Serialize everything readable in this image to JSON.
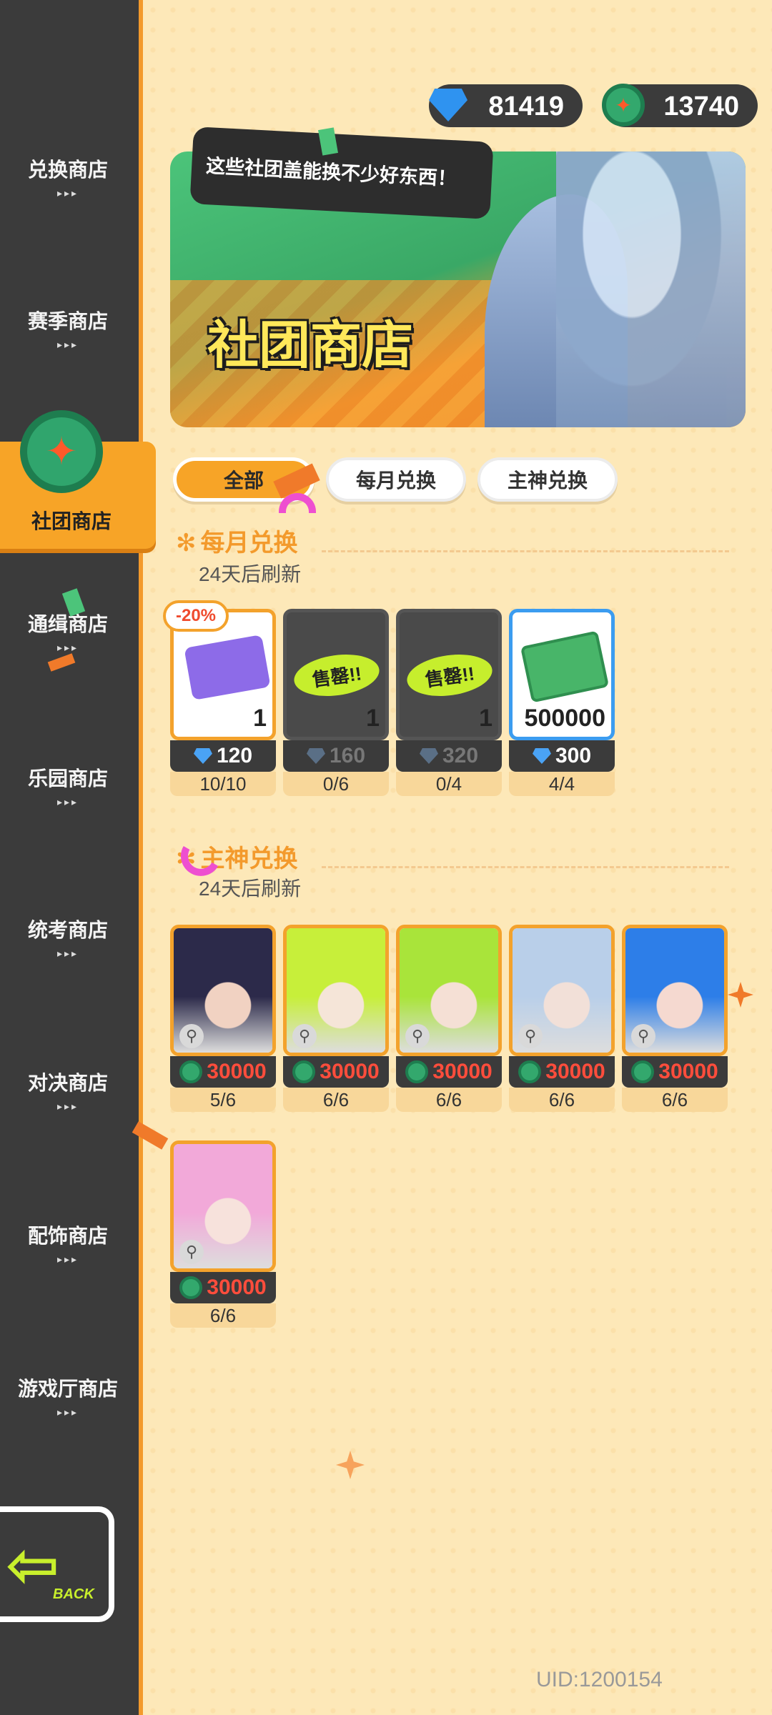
{
  "sidebar": {
    "items": [
      {
        "label": "兑换商店"
      },
      {
        "label": "赛季商店"
      },
      {
        "label": "社团商店"
      },
      {
        "label": "通缉商店"
      },
      {
        "label": "乐园商店"
      },
      {
        "label": "统考商店"
      },
      {
        "label": "对决商店"
      },
      {
        "label": "配饰商店"
      },
      {
        "label": "游戏厅商店"
      }
    ],
    "active_label": "社团商店",
    "dots": "▸▸▸",
    "back_label": "BACK"
  },
  "currency": {
    "gems": "81419",
    "caps": "13740"
  },
  "banner": {
    "speech": "这些社团盖能换不少好东西！",
    "title": "社团商店"
  },
  "tabs": [
    {
      "label": "全部",
      "active": true
    },
    {
      "label": "每月兑换",
      "active": false
    },
    {
      "label": "主神兑换",
      "active": false
    }
  ],
  "sections": {
    "monthly": {
      "title": "每月兑换",
      "refresh": "24天后刷新",
      "items": [
        {
          "qty": "1",
          "price": "120",
          "limit": "10/10",
          "discount": "-20%",
          "sold": false,
          "icon": "ticket-icon"
        },
        {
          "qty": "1",
          "price": "160",
          "limit": "0/6",
          "sold": true,
          "sold_label": "售罄!!",
          "icon": "item-icon"
        },
        {
          "qty": "1",
          "price": "320",
          "limit": "0/4",
          "sold": true,
          "sold_label": "售罄!!",
          "icon": "item-icon"
        },
        {
          "qty": "500000",
          "price": "300",
          "limit": "4/4",
          "sold": false,
          "icon": "cash-icon"
        }
      ]
    },
    "god": {
      "title": "主神兑换",
      "refresh": "24天后刷新",
      "items": [
        {
          "price": "30000",
          "limit": "5/6",
          "colors": [
            "#2c2a4a",
            "#f1d2c2"
          ]
        },
        {
          "price": "30000",
          "limit": "6/6",
          "colors": [
            "#c7ef3a",
            "#f5e5d8"
          ]
        },
        {
          "price": "30000",
          "limit": "6/6",
          "colors": [
            "#a9e43a",
            "#f5e0d5"
          ]
        },
        {
          "price": "30000",
          "limit": "6/6",
          "colors": [
            "#b9cfe9",
            "#f2e0d8"
          ]
        },
        {
          "price": "30000",
          "limit": "6/6",
          "colors": [
            "#2d7ee8",
            "#f5d9d0"
          ]
        },
        {
          "price": "30000",
          "limit": "6/6",
          "colors": [
            "#f2a9d9",
            "#f7e2dc"
          ]
        }
      ]
    }
  },
  "uid": "UID:1200154"
}
